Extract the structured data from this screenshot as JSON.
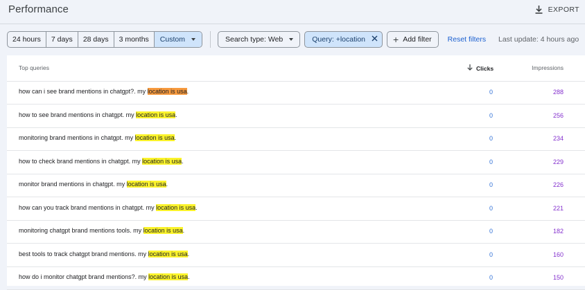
{
  "header": {
    "title": "Performance",
    "export_label": "EXPORT"
  },
  "filters": {
    "date_ranges": [
      "24 hours",
      "7 days",
      "28 days",
      "3 months"
    ],
    "custom_label": "Custom",
    "search_type_label": "Search type: Web",
    "query_filter_label": "Query: +location",
    "add_filter_label": "Add filter",
    "reset_label": "Reset filters",
    "last_update": "Last update: 4 hours ago"
  },
  "table": {
    "columns": {
      "query": "Top queries",
      "clicks": "Clicks",
      "impressions": "Impressions"
    },
    "rows": [
      {
        "prefix": "how can i see brand mentions in chatgpt?. my ",
        "highlight": "location is usa",
        "suffix": ".",
        "clicks": "0",
        "impressions": "288"
      },
      {
        "prefix": "how to see brand mentions in chatgpt. my ",
        "highlight": "location is usa",
        "suffix": ".",
        "clicks": "0",
        "impressions": "256"
      },
      {
        "prefix": "monitoring brand mentions in chatgpt. my ",
        "highlight": "location is usa",
        "suffix": ".",
        "clicks": "0",
        "impressions": "234"
      },
      {
        "prefix": "how to check brand mentions in chatgpt. my ",
        "highlight": "location is usa",
        "suffix": ".",
        "clicks": "0",
        "impressions": "229"
      },
      {
        "prefix": "monitor brand mentions in chatgpt. my ",
        "highlight": "location is usa",
        "suffix": ".",
        "clicks": "0",
        "impressions": "226"
      },
      {
        "prefix": "how can you track brand mentions in chatgpt. my ",
        "highlight": "location is usa",
        "suffix": ".",
        "clicks": "0",
        "impressions": "221"
      },
      {
        "prefix": "monitoring chatgpt brand mentions tools. my ",
        "highlight": "location is usa",
        "suffix": ".",
        "clicks": "0",
        "impressions": "182"
      },
      {
        "prefix": "best tools to track chatgpt brand mentions. my ",
        "highlight": "location is usa",
        "suffix": ".",
        "clicks": "0",
        "impressions": "160"
      },
      {
        "prefix": "how do i monitor chatgpt brand mentions?. my ",
        "highlight": "location is usa",
        "suffix": ".",
        "clicks": "0",
        "impressions": "150"
      }
    ]
  },
  "colors": {
    "highlight_active": "#f79a3e",
    "highlight": "#fbf32b",
    "clicks": "#2f6fd6",
    "impressions": "#8430ce",
    "active_chip": "#cfe4fb"
  },
  "icons": [
    "download-icon",
    "caret-down-icon",
    "close-icon",
    "plus-icon",
    "arrow-down-icon"
  ]
}
